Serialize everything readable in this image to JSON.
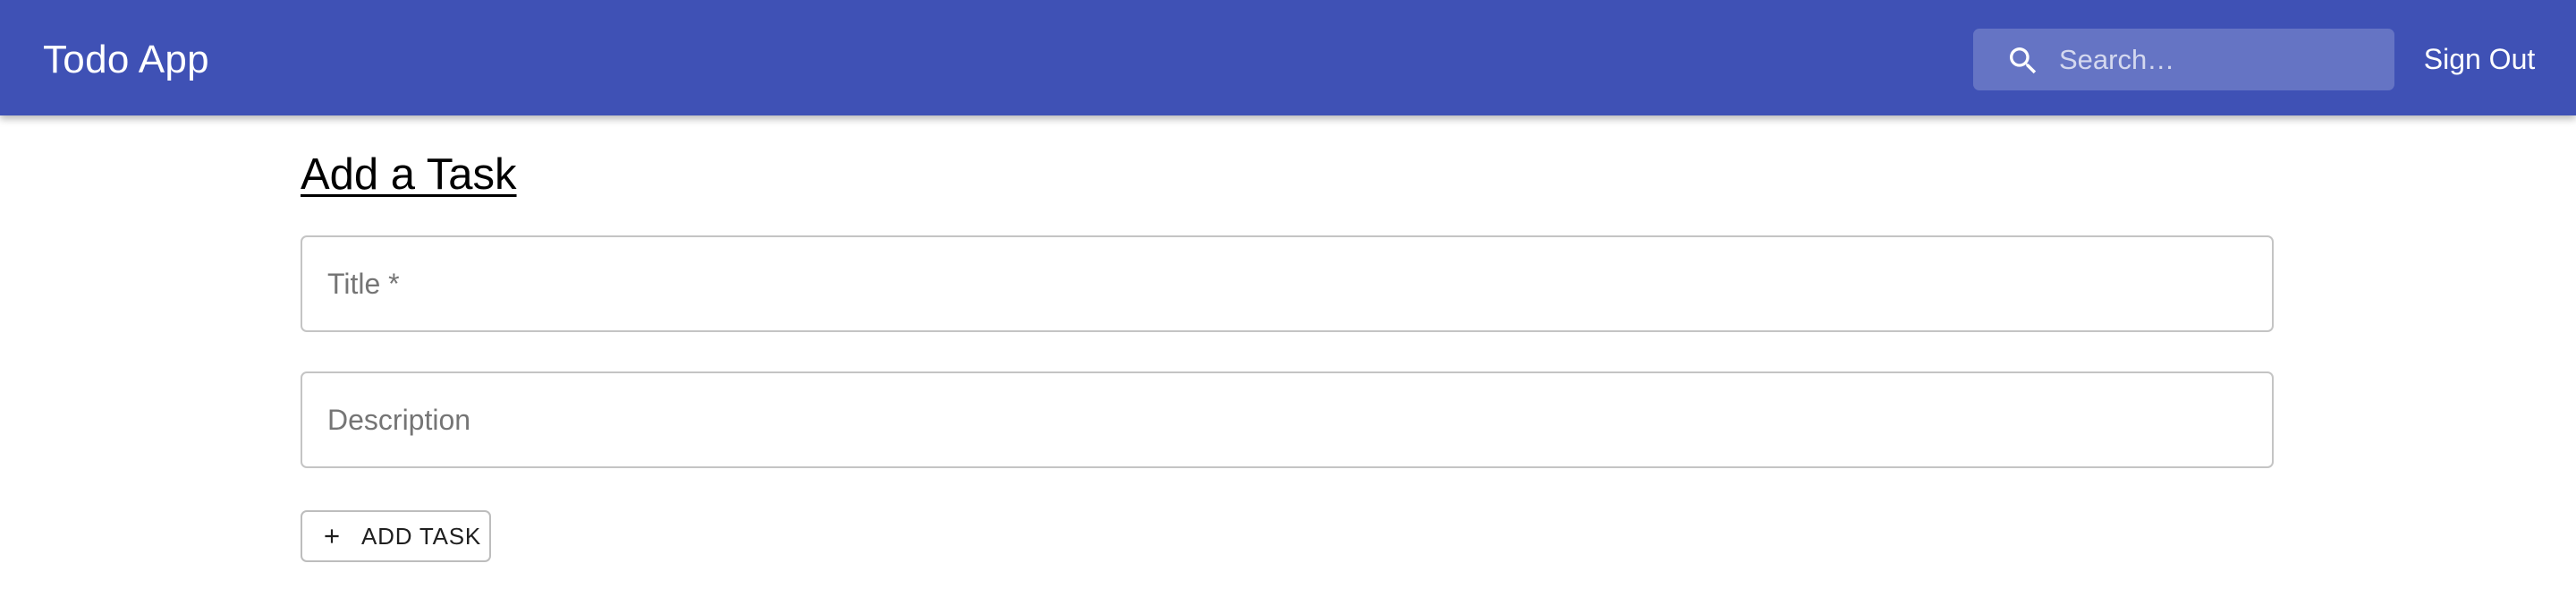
{
  "appbar": {
    "title": "Todo App",
    "search": {
      "placeholder": "Search…",
      "value": "",
      "icon": "search-icon"
    },
    "sign_out_label": "Sign Out"
  },
  "form": {
    "heading": "Add a Task",
    "title_field": {
      "placeholder": "Title *",
      "value": ""
    },
    "description_field": {
      "placeholder": "Description",
      "value": ""
    },
    "add_button": {
      "label": "ADD TASK",
      "icon": "plus-icon"
    }
  },
  "colors": {
    "appbar": "#3f51b5",
    "search_bg": "#6574c4",
    "border": "#c4c4c4"
  }
}
